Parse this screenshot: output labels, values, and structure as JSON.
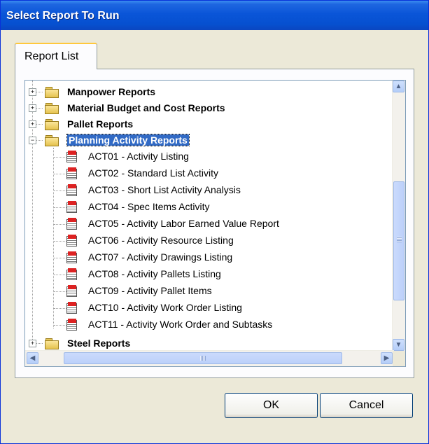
{
  "window": {
    "title": "Select Report To Run"
  },
  "tabs": [
    {
      "label": "Report List"
    }
  ],
  "tree": {
    "categories_before": [
      {
        "label": "Manpower Reports",
        "expander": "+"
      },
      {
        "label": "Material Budget and Cost Reports",
        "expander": "+"
      },
      {
        "label": "Pallet Reports",
        "expander": "+"
      }
    ],
    "expanded": {
      "label": "Planning Activity Reports",
      "expander": "−"
    },
    "reports": [
      "ACT01 - Activity Listing",
      "ACT02 - Standard List Activity",
      "ACT03 - Short List  Activity Analysis",
      "ACT04 - Spec Items  Activity",
      "ACT05 - Activity Labor Earned Value Report",
      "ACT06 - Activity Resource Listing",
      "ACT07 - Activity Drawings Listing",
      "ACT08 - Activity Pallets Listing",
      "ACT09 - Activity Pallet Items",
      "ACT10 - Activity Work Order Listing",
      "ACT11 - Activity Work Order and Subtasks"
    ],
    "categories_after": [
      {
        "label": "Steel Reports",
        "expander": "+"
      }
    ]
  },
  "scroll": {
    "up": "▲",
    "down": "▼",
    "left": "◀",
    "right": "▶"
  },
  "buttons": {
    "ok": "OK",
    "cancel": "Cancel"
  },
  "icons": {
    "folder": "folder-icon",
    "report": "report-icon"
  },
  "colors": {
    "selection": "#316ac5",
    "titlebar": "#0a55d8"
  }
}
